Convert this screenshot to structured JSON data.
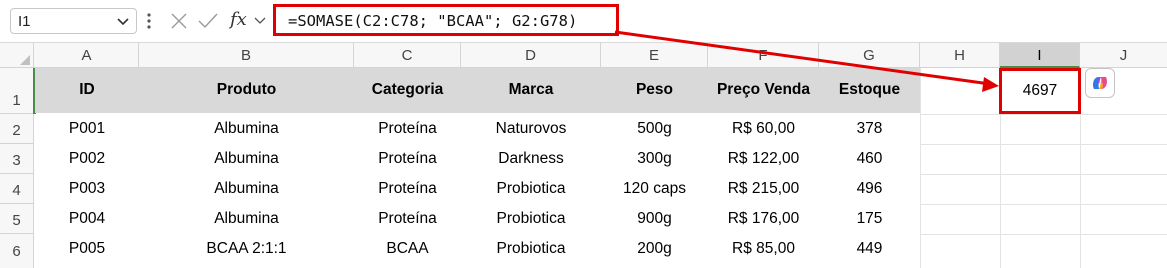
{
  "name_box": {
    "value": "I1"
  },
  "formula_bar": {
    "fx_label": "fx",
    "formula": "=SOMASE(C2:C78; \"BCAA\"; G2:G78)"
  },
  "columns": [
    "A",
    "B",
    "C",
    "D",
    "E",
    "F",
    "G",
    "H",
    "I",
    "J"
  ],
  "selected_column": "I",
  "rows": [
    "1",
    "2",
    "3",
    "4",
    "5",
    "6"
  ],
  "table": {
    "headers": [
      "ID",
      "Produto",
      "Categoria",
      "Marca",
      "Peso",
      "Preço Venda",
      "Estoque"
    ],
    "rows": [
      [
        "P001",
        "Albumina",
        "Proteína",
        "Naturovos",
        "500g",
        "R$ 60,00",
        "378"
      ],
      [
        "P002",
        "Albumina",
        "Proteína",
        "Darkness",
        "300g",
        "R$ 122,00",
        "460"
      ],
      [
        "P003",
        "Albumina",
        "Proteína",
        "Probiotica",
        "120 caps",
        "R$ 215,00",
        "496"
      ],
      [
        "P004",
        "Albumina",
        "Proteína",
        "Probiotica",
        "900g",
        "R$ 176,00",
        "175"
      ],
      [
        "P005",
        "BCAA 2:1:1",
        "BCAA",
        "Probiotica",
        "200g",
        "R$ 85,00",
        "449"
      ]
    ]
  },
  "result_cell": {
    "address": "I1",
    "value": "4697"
  },
  "colors": {
    "highlight_red": "#e00000",
    "header_fill": "#d9d9d9",
    "selection_green": "#4a8a4a"
  }
}
